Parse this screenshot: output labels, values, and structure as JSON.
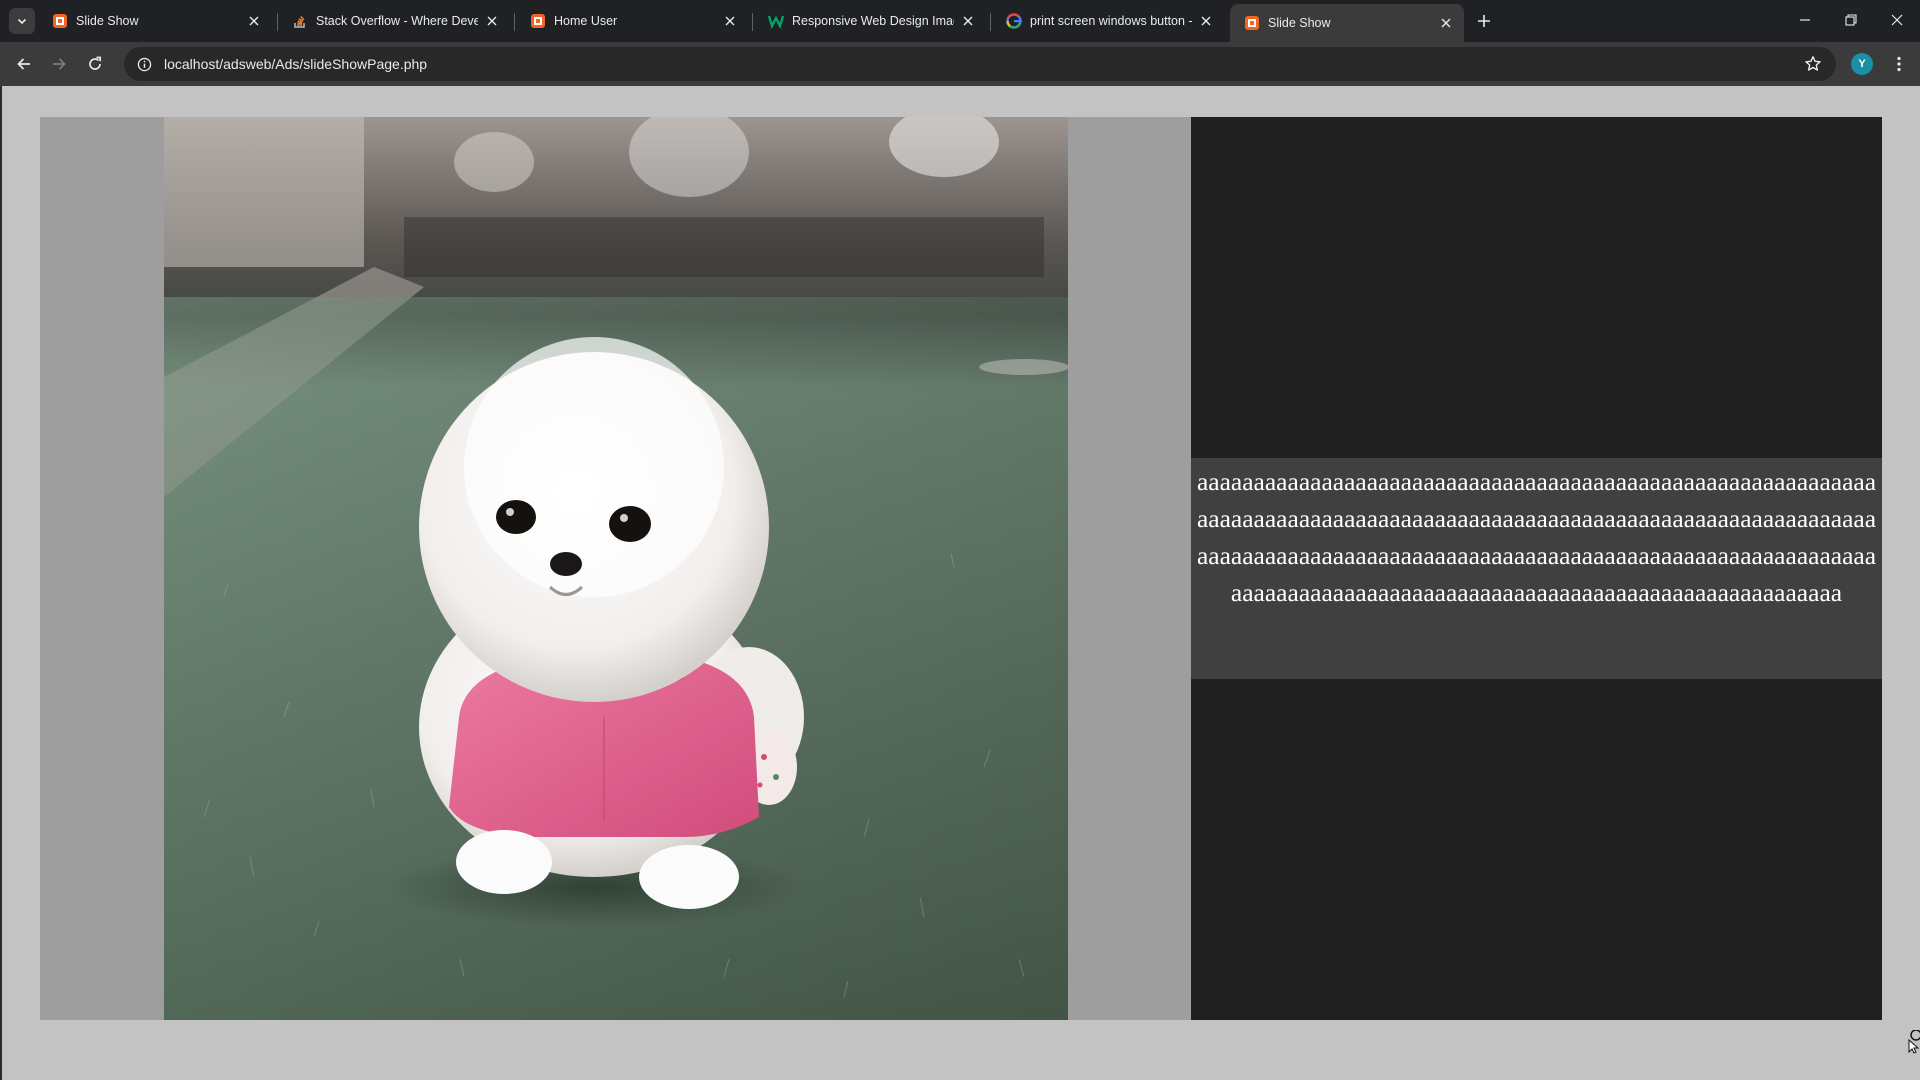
{
  "browser": {
    "tabs": [
      {
        "title": "Slide Show",
        "favicon": "localhost-icon",
        "active": false
      },
      {
        "title": "Stack Overflow - Where Developers",
        "favicon": "stackoverflow-icon",
        "active": false
      },
      {
        "title": "Home User",
        "favicon": "localhost-icon",
        "active": false
      },
      {
        "title": "Responsive Web Design Images",
        "favicon": "w3schools-icon",
        "active": false
      },
      {
        "title": "print screen windows button - Google",
        "favicon": "google-icon",
        "active": false
      },
      {
        "title": "Slide Show",
        "favicon": "localhost-icon",
        "active": true
      }
    ],
    "address": "localhost/adsweb/Ads/slideShowPage.php",
    "profile_initial": "Y",
    "colors": {
      "avatar": "#1a8fa5",
      "localhost_favicon": "#f26522",
      "chrome_dark": "#202124"
    }
  },
  "slide": {
    "image_subject": "dog-photo",
    "caption": "aaaaaaaaaaaaaaaaaaaaaaaaaaaaaaaaaaaaaaaaaaaaaaaaaaaaaaaaaaaaaaaaaaaaaaaaaaaaaaaaaaaaaaaaaaaaaaaaaaaaaaaaaaaaaaaaaaaaaaaaaaaaaaaaaaaaaaaaaaaaaaaaaaaaaaaaaaaaaaaaaaaaaaaaaaaaaaaaaaaaaaaaaaaaaaaaaaaaaaaaaaaaaaaaaaaaaaaaaaaaaaaaaaaaaaaaaa"
  }
}
